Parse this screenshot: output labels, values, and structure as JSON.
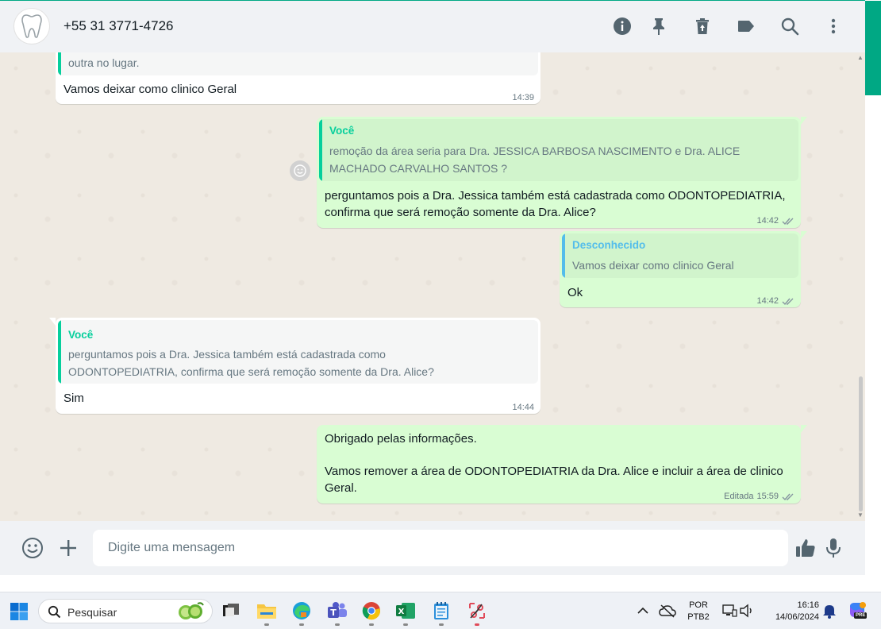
{
  "header": {
    "contact_name": "+55 31 3771-4726",
    "icons": [
      "info-icon",
      "pin-icon",
      "delete-icon",
      "label-icon",
      "search-icon",
      "menu-icon"
    ]
  },
  "messages": [
    {
      "id": "m1",
      "direction": "in",
      "quote_tail_text": "outra no lugar.",
      "text": "Vamos deixar como clinico Geral",
      "time": "14:39"
    },
    {
      "id": "m2",
      "direction": "out",
      "quote_author": "Você",
      "quote_text_line1": "remoção da área seria para Dra. JESSICA BARBOSA NASCIMENTO e Dra. ALICE",
      "quote_text_line2": "MACHADO CARVALHO SANTOS ?",
      "text_line1": "perguntamos pois a Dra. Jessica também está cadastrada como ODONTOPEDIATRIA,",
      "text_line2": "confirma que será remoção somente da Dra. Alice?",
      "time": "14:42"
    },
    {
      "id": "m3",
      "direction": "out",
      "quote_author": "Desconhecido",
      "quote_text": "Vamos deixar como clinico Geral",
      "text": "Ok",
      "time": "14:42"
    },
    {
      "id": "m4",
      "direction": "in",
      "quote_author": "Você",
      "quote_text_line1": "perguntamos pois a Dra. Jessica também está cadastrada como",
      "quote_text_line2": "ODONTOPEDIATRIA, confirma que será remoção somente da Dra. Alice?",
      "text": "Sim",
      "time": "14:44"
    },
    {
      "id": "m5",
      "direction": "out",
      "text_line1": "Obrigado pelas informações.",
      "text_line2": "Vamos remover a área de ODONTOPEDIATRIA da Dra. Alice e incluir a área de clinico",
      "text_line3": "Geral.",
      "edited_label": "Editada",
      "time": "15:59"
    }
  ],
  "composer": {
    "placeholder": "Digite uma mensagem"
  },
  "taskbar": {
    "search_label": "Pesquisar",
    "lang_line1": "POR",
    "lang_line2": "PTB2",
    "time": "16:16",
    "date": "14/06/2024",
    "copilot_badge": "PRE"
  },
  "colors": {
    "accent": "#00a884",
    "quote_you": "#06cf9c",
    "quote_unknown": "#53bdeb",
    "bubble_out": "#d9fdd3",
    "chat_bg": "#efeae2",
    "read_ticks": "#8696a0"
  }
}
